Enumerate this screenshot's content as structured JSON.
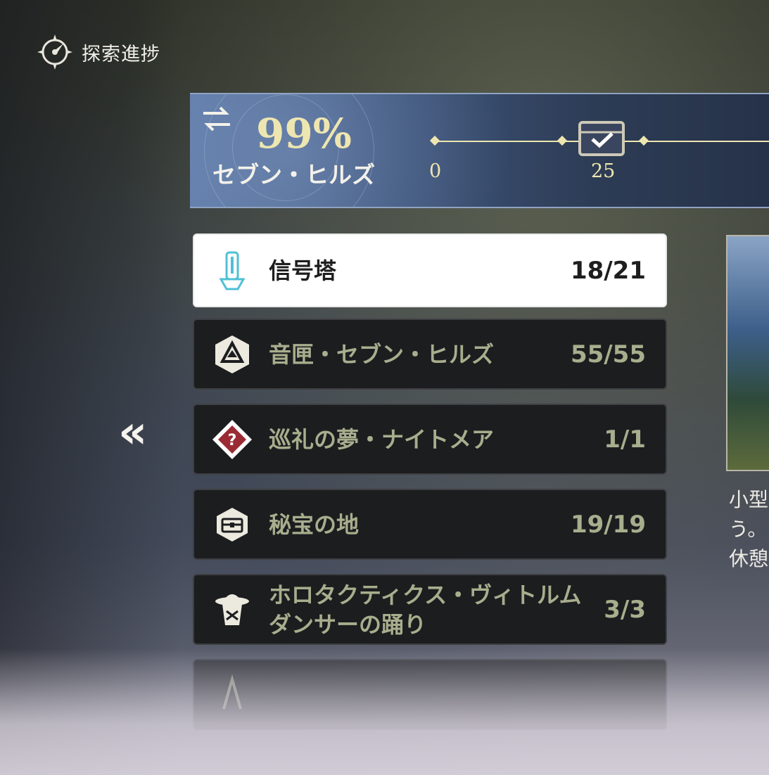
{
  "header": {
    "title": "探索進捗",
    "icon": "compass-icon"
  },
  "banner": {
    "percent": "99%",
    "region": "セブン・ヒルズ",
    "milestones": [
      "0",
      "25"
    ],
    "swap_icon": "swap-arrows-icon",
    "milestone_icon": "chest-check-icon",
    "accent_color": "#eee6b0"
  },
  "list": {
    "items": [
      {
        "label": "信号塔",
        "count": "18/21",
        "icon": "signal-tower-icon",
        "active": true
      },
      {
        "label": "音匣・セブン・ヒルズ",
        "count": "55/55",
        "icon": "sound-box-icon"
      },
      {
        "label": "巡礼の夢・ナイトメア",
        "count": "1/1",
        "icon": "nightmare-question-icon"
      },
      {
        "label": "秘宝の地",
        "count": "19/19",
        "icon": "treasure-chest-icon"
      },
      {
        "label": "ホロタクティクス・ヴィトルム\nダンサーの踊り",
        "label_line1": "ホロタクティクス・ヴィトルム",
        "label_line2": "ダンサーの踊り",
        "count": "3/3",
        "icon": "dancer-hat-icon"
      },
      {
        "label": "",
        "count": "",
        "icon": "partial-item-icon"
      }
    ]
  },
  "navigation": {
    "back_label": "«"
  },
  "preview": {
    "text_lines": [
      "小型",
      "う。",
      "休憩"
    ]
  }
}
